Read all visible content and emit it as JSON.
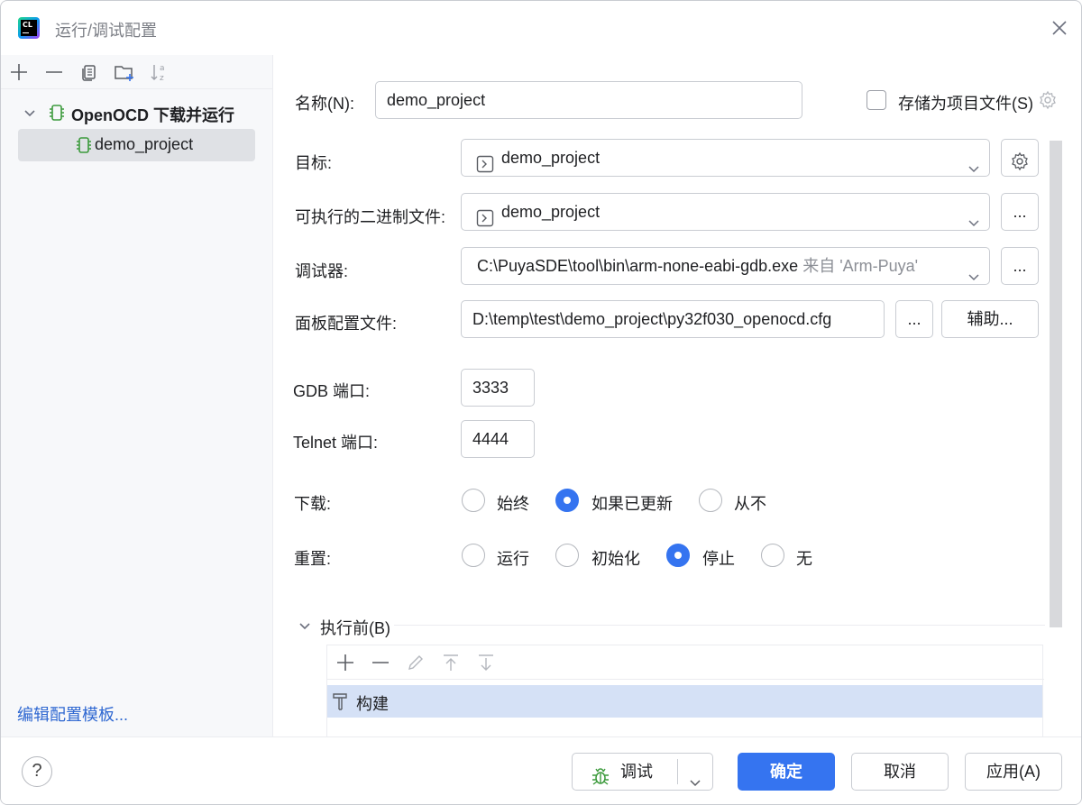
{
  "window": {
    "title": "运行/调试配置"
  },
  "left": {
    "toolbar": [
      "add-icon",
      "remove-icon",
      "copy-icon",
      "new-folder-icon",
      "sort-icon"
    ],
    "tree": {
      "group_label": "OpenOCD 下载并运行",
      "child_label": "demo_project"
    },
    "edit_templates": "编辑配置模板..."
  },
  "form": {
    "name_label": "名称(N):",
    "name_value": "demo_project",
    "store_as_file_label": "存储为项目文件(S)",
    "target_label": "目标:",
    "target_value": "demo_project",
    "executable_label": "可执行的二进制文件:",
    "executable_value": "demo_project",
    "debugger_label": "调试器:",
    "debugger_value": "C:\\PuyaSDE\\tool\\bin\\arm-none-eabi-gdb.exe",
    "debugger_suffix": "来自 'Arm-Puya'",
    "board_label": "面板配置文件:",
    "board_value": "D:\\temp\\test\\demo_project\\py32f030_openocd.cfg",
    "ellipsis": "...",
    "assist_label": "辅助...",
    "gdb_port_label": "GDB 端口:",
    "gdb_port_value": "3333",
    "telnet_port_label": "Telnet 端口:",
    "telnet_port_value": "4444",
    "download_label": "下载:",
    "download_options": [
      "始终",
      "如果已更新",
      "从不"
    ],
    "download_selected": "如果已更新",
    "reset_label": "重置:",
    "reset_options": [
      "运行",
      "初始化",
      "停止",
      "无"
    ],
    "reset_selected": "停止",
    "before_launch_label": "执行前(B)",
    "before_launch_items": [
      "构建"
    ]
  },
  "footer": {
    "help": "?",
    "debug_label": "调试",
    "ok_label": "确定",
    "cancel_label": "取消",
    "apply_label": "应用(A)"
  },
  "colors": {
    "accent": "#3574f0",
    "link": "#2e67d1",
    "selection": "#d5e1f6"
  }
}
